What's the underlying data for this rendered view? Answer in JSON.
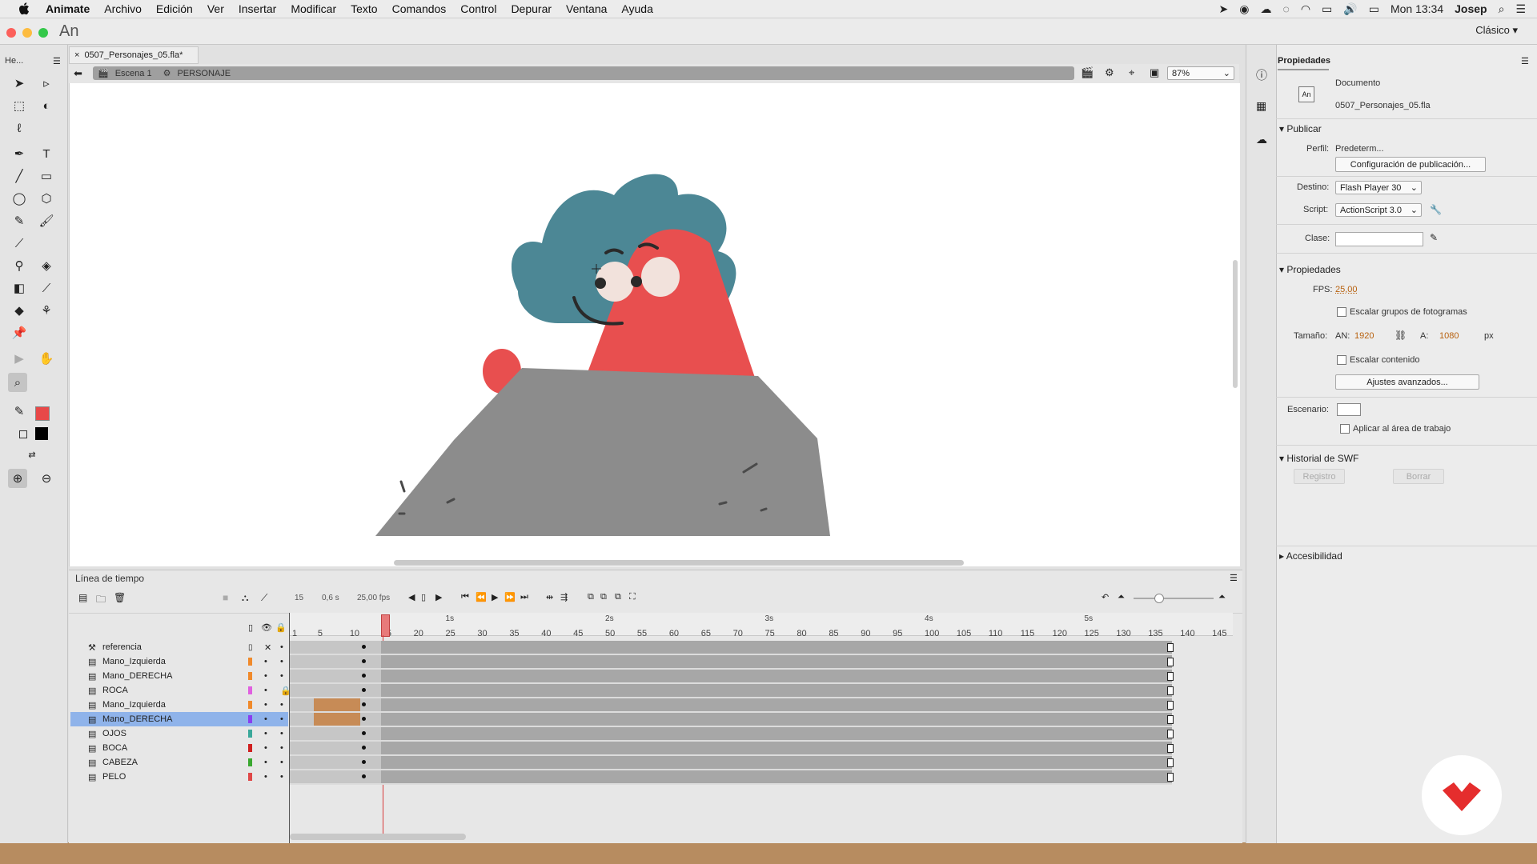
{
  "menubar": {
    "app": "Animate",
    "items": [
      "Archivo",
      "Edición",
      "Ver",
      "Insertar",
      "Modificar",
      "Texto",
      "Comandos",
      "Control",
      "Depurar",
      "Ventana",
      "Ayuda"
    ],
    "clock": "Mon 13:34",
    "user": "Josep"
  },
  "window": {
    "logo": "An",
    "workspace": "Clásico ▾"
  },
  "tools_panel": {
    "header": "He..."
  },
  "document": {
    "tab_label": "0507_Personajes_05.fla*",
    "scene": "Escena 1",
    "symbol": "PERSONAJE",
    "zoom": "87%"
  },
  "timeline": {
    "title": "Línea de tiempo",
    "current_frame": "15",
    "time": "0,6 s",
    "fps": "25,00 fps",
    "ruler_labels": [
      "1",
      "5",
      "10",
      "15",
      "20",
      "25",
      "30",
      "35",
      "40",
      "45",
      "50",
      "55",
      "60",
      "65",
      "70",
      "75",
      "80",
      "85",
      "90",
      "95",
      "100",
      "105",
      "110",
      "115",
      "120",
      "125",
      "130",
      "135",
      "140",
      "145"
    ],
    "seconds": [
      "1s",
      "2s",
      "3s",
      "4s",
      "5s"
    ],
    "layers": [
      {
        "name": "referencia",
        "color": "",
        "type": "guide"
      },
      {
        "name": "Mano_Izquierda",
        "color": "#f08a2b",
        "type": "layer"
      },
      {
        "name": "Mano_DERECHA",
        "color": "#f08a2b",
        "type": "layer"
      },
      {
        "name": "ROCA",
        "color": "#e060e0",
        "type": "locked"
      },
      {
        "name": "Mano_Izquierda",
        "color": "#f08a2b",
        "type": "layer"
      },
      {
        "name": "Mano_DERECHA",
        "color": "#8a3ff0",
        "type": "selected"
      },
      {
        "name": "OJOS",
        "color": "#3aa89a",
        "type": "layer"
      },
      {
        "name": "BOCA",
        "color": "#d02020",
        "type": "layer"
      },
      {
        "name": "CABEZA",
        "color": "#3aa830",
        "type": "layer"
      },
      {
        "name": "PELO",
        "color": "#e04848",
        "type": "layer"
      }
    ]
  },
  "properties": {
    "tab": "Propiedades",
    "doc_type": "Documento",
    "doc_name": "0507_Personajes_05.fla",
    "publish_header": "Publicar",
    "profile_label": "Perfil:",
    "profile_value": "Predeterm...",
    "publish_settings": "Configuración de publicación...",
    "target_label": "Destino:",
    "target_value": "Flash Player 30",
    "script_label": "Script:",
    "script_value": "ActionScript 3.0",
    "class_label": "Clase:",
    "props_header": "Propiedades",
    "fps_label": "FPS:",
    "fps_value": "25,00",
    "scale_groups": "Escalar grupos de fotogramas",
    "size_label": "Tamaño:",
    "width_label": "AN:",
    "width_value": "1920",
    "height_label": "A:",
    "height_value": "1080",
    "unit": "px",
    "scale_content": "Escalar contenido",
    "advanced": "Ajustes avanzados...",
    "stage_label": "Escenario:",
    "apply_workarea": "Aplicar al área de trabajo",
    "swf_header": "Historial de SWF",
    "log_btn": "Registro",
    "clear_btn": "Borrar",
    "accessibility": "Accesibilidad"
  },
  "colors": {
    "stroke": "#ffffff",
    "fill": "#e84848",
    "character_red": "#e84f4f",
    "hair": "#4c8795",
    "rock": "#8c8c8c",
    "playhead": "#d83a3a"
  }
}
